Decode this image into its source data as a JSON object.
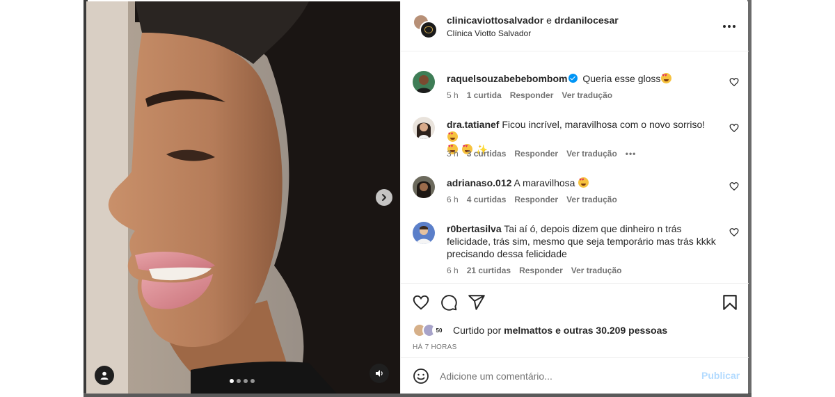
{
  "post": {
    "authors": "clinicaviottosalvador",
    "connector": "e",
    "coauthor": "drdanilocesar",
    "location": "Clínica Viotto Salvador",
    "more_icon": "more-horizontal-icon"
  },
  "media": {
    "next_icon": "chevron-right-icon",
    "tag_icon": "user-tag-icon",
    "audio_icon": "speaker-icon",
    "carousel_total": 4,
    "carousel_active": 1
  },
  "comments": [
    {
      "username": "raquelsouzabebebombom",
      "verified": true,
      "text": "Queria esse gloss",
      "time": "5 h",
      "likes": "1 curtida",
      "reply": "Responder",
      "translate": "Ver tradução"
    },
    {
      "username": "dra.tatianef",
      "verified": false,
      "text": "Ficou incrível, maravilhosa com o novo sorriso!",
      "time": "3 h",
      "likes": "3 curtidas",
      "reply": "Responder",
      "translate": "Ver tradução"
    },
    {
      "username": "adrianaso.012",
      "verified": false,
      "text": "A maravilhosa",
      "time": "6 h",
      "likes": "4 curtidas",
      "reply": "Responder",
      "translate": "Ver tradução"
    },
    {
      "username": "r0bertasilva",
      "verified": false,
      "text": "Tai aí ó, depois dizem que dinheiro n trás felicidade, trás sim, mesmo que seja temporário mas trás kkkk precisando dessa felicidade",
      "time": "6 h",
      "likes": "21 curtidas",
      "reply": "Responder",
      "translate": "Ver tradução"
    }
  ],
  "actions": {
    "like_icon": "heart-icon",
    "comment_icon": "comment-icon",
    "share_icon": "send-icon",
    "save_icon": "bookmark-icon"
  },
  "likes": {
    "prefix": "Curtido por",
    "user": "melmattos",
    "suffix": "e outras 30.209 pessoas"
  },
  "time_ago": "HÁ 7 HORAS",
  "composer": {
    "placeholder": "Adicione um comentário...",
    "publish": "Publicar",
    "emoji_icon": "smiley-icon"
  },
  "colors": {
    "text": "#262626",
    "secondary": "#737373",
    "verified": "#0095f6",
    "publish_disabled": "#b3dbff",
    "divider": "#efefef"
  }
}
